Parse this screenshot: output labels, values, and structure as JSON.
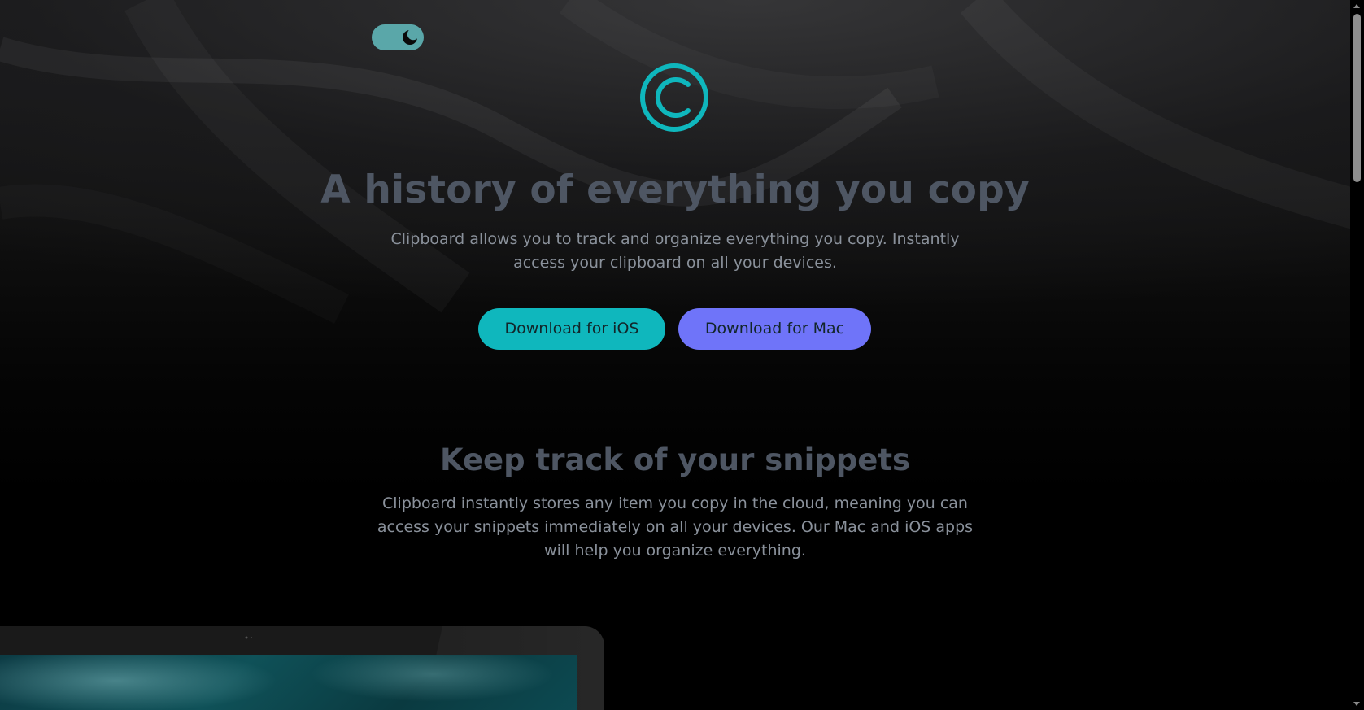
{
  "theme_toggle": {
    "icon": "moon-icon",
    "state": "dark",
    "color": "#5aa7a9"
  },
  "logo": {
    "icon": "copyright-c-icon",
    "color": "#0fb7bd"
  },
  "hero": {
    "title": "A history of everything you copy",
    "subtitle": "Clipboard allows you to track and organize everything you copy. Instantly access your clipboard on all your devices.",
    "buttons": {
      "ios_label": "Download for iOS",
      "mac_label": "Download for Mac"
    }
  },
  "snippets_section": {
    "title": "Keep track of your snippets",
    "description": "Clipboard instantly stores any item you copy in the cloud, meaning you can access your snippets immediately on all your devices. Our Mac and iOS apps will help you organize everything."
  },
  "colors": {
    "accent_cyan": "#0fb7bd",
    "accent_purple": "#6f74f9",
    "heading": "#4e5663",
    "body_text": "#8a919b",
    "background": "#000000"
  }
}
